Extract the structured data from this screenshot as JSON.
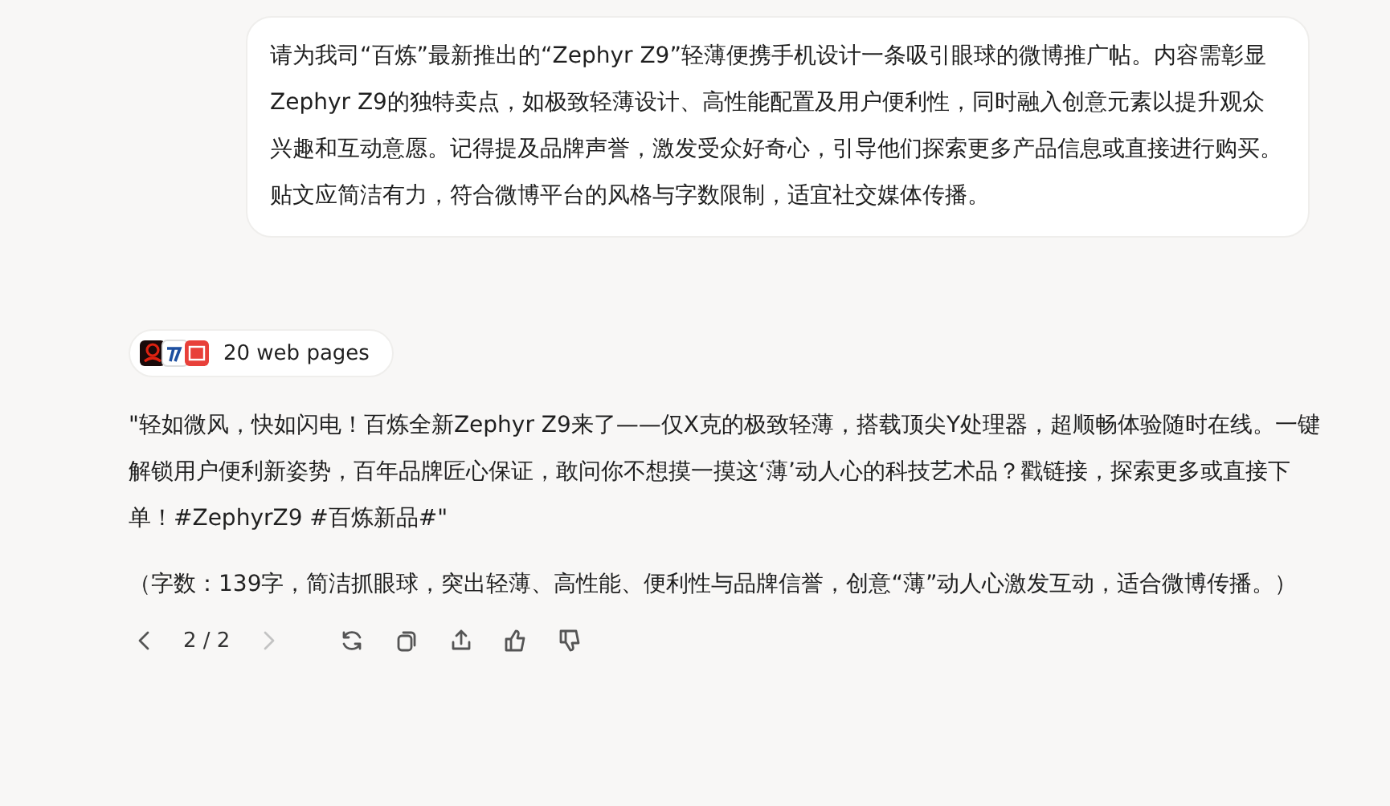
{
  "user_message": {
    "text": "请为我司“百炼”最新推出的“Zephyr Z9”轻薄便携手机设计一条吸引眼球的微博推广帖。内容需彰显Zephyr Z9的独特卖点，如极致轻薄设计、高性能配置及用户便利性，同时融入创意元素以提升观众兴趣和互动意愿。记得提及品牌声誉，激发受众好奇心，引导他们探索更多产品信息或直接进行购买。贴文应简洁有力，符合微博平台的风格与字数限制，适宜社交媒体传播。"
  },
  "sources": {
    "label": "20 web pages"
  },
  "answer": {
    "paragraphs": [
      "\"轻如微风，快如闪电！百炼全新Zephyr Z9来了——仅X克的极致轻薄，搭载顶尖Y处理器，超顺畅体验随时在线。一键解锁用户便利新姿势，百年品牌匠心保证，敢问你不想摸一摸这‘薄’动人心的科技艺术品？戳链接，探索更多或直接下单！#ZephyrZ9 #百炼新品#\"",
      "（字数：139字，简洁抓眼球，突出轻薄、高性能、便利性与品牌信誉，创意“薄”动人心激发互动，适合微博传播。）"
    ]
  },
  "toolbar": {
    "prev_disabled": false,
    "page": "2 / 2",
    "next_disabled": true
  }
}
